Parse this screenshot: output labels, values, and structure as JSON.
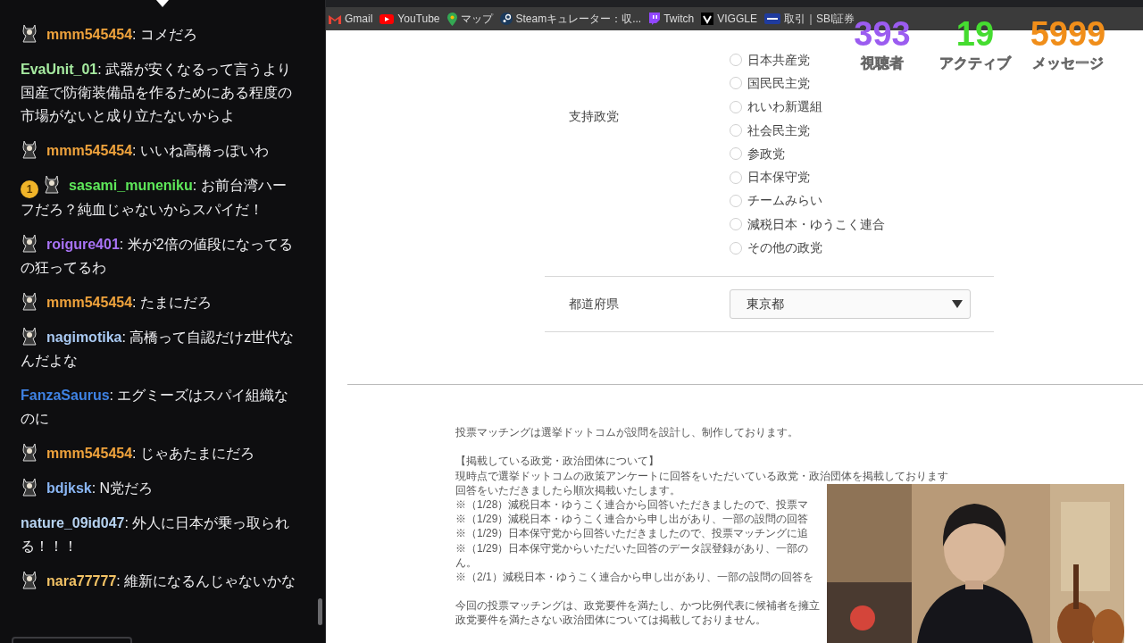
{
  "chat": {
    "messages": [
      {
        "badges": [
          {
            "kind": "avatar"
          }
        ],
        "user": "mmm545454",
        "color": "#eea23c",
        "text": ": コメだろ"
      },
      {
        "user": "EvaUnit_01",
        "color": "#a6eaa0",
        "text": ": 武器が安くなるって言うより国産で防衛装備品を作るためにある程度の市場がないと成り立たないからよ"
      },
      {
        "badges": [
          {
            "kind": "avatar"
          }
        ],
        "user": "mmm545454",
        "color": "#eea23c",
        "text": ": いいね高橋っぽいわ"
      },
      {
        "badges": [
          {
            "kind": "count",
            "text": "1"
          },
          {
            "kind": "avatar"
          }
        ],
        "user": "sasami_muneniku",
        "color": "#5ee85a",
        "text": ": お前台湾ハーフだろ？純血じゃないからスパイだ！"
      },
      {
        "badges": [
          {
            "kind": "avatar"
          }
        ],
        "user": "roigure401",
        "color": "#a873f5",
        "text": ": 米が2倍の値段になってるの狂ってるわ"
      },
      {
        "badges": [
          {
            "kind": "avatar"
          }
        ],
        "user": "mmm545454",
        "color": "#eea23c",
        "text": ": たまにだろ"
      },
      {
        "badges": [
          {
            "kind": "avatar"
          }
        ],
        "user": "nagimotika",
        "color": "#a9c9f2",
        "text": ": 高橋って自認だけz世代なんだよな"
      },
      {
        "user": "FanzaSaurus",
        "color": "#3f82e2",
        "text": ": エグミーズはスパイ組織なのに"
      },
      {
        "badges": [
          {
            "kind": "avatar"
          }
        ],
        "user": "mmm545454",
        "color": "#eea23c",
        "text": ": じゃあたまにだろ"
      },
      {
        "badges": [
          {
            "kind": "avatar"
          }
        ],
        "user": "bdjksk",
        "color": "#8ab6f4",
        "text": ": N党だろ"
      },
      {
        "user": "nature_09id047",
        "color": "#b6d2f0",
        "text": ": 外人に日本が乗っ取られる！！！"
      },
      {
        "badges": [
          {
            "kind": "avatar"
          }
        ],
        "user": "nara77777",
        "color": "#f2c265",
        "text": ": 維新になるんじゃないかな"
      }
    ]
  },
  "bookmarks": [
    {
      "kind": "gmail",
      "label": "Gmail"
    },
    {
      "kind": "youtube",
      "label": "YouTube"
    },
    {
      "kind": "maps",
      "label": "マップ"
    },
    {
      "kind": "steam",
      "label": "Steamキュレーター：収..."
    },
    {
      "kind": "twitch",
      "label": "Twitch"
    },
    {
      "kind": "viggle",
      "label": "VIGGLE"
    },
    {
      "kind": "sbi",
      "label": "取引｜SBI証券"
    }
  ],
  "stats": [
    {
      "value": "393",
      "label": "視聴者",
      "color": "#9b5cf0"
    },
    {
      "value": "19",
      "label": "アクティブ",
      "color": "#45dc30"
    },
    {
      "value": "5999",
      "label": "メッセージ",
      "color": "#f08e1a"
    }
  ],
  "form": {
    "party": {
      "label": "支持政党",
      "options": [
        {
          "label": "日本共産党",
          "selected": false
        },
        {
          "label": "国民民主党",
          "selected": false
        },
        {
          "label": "れいわ新選組",
          "selected": false
        },
        {
          "label": "社会民主党",
          "selected": false
        },
        {
          "label": "参政党",
          "selected": false
        },
        {
          "label": "日本保守党",
          "selected": false
        },
        {
          "label": "チームみらい",
          "selected": false
        },
        {
          "label": "減税日本・ゆうこく連合",
          "selected": false
        },
        {
          "label": "その他の政党",
          "selected": false
        }
      ]
    },
    "prefecture": {
      "label": "都道府県",
      "value": "東京都"
    }
  },
  "notice": [
    [
      "投票マッチングは選挙ドットコムが設問を設計し、制作しております。"
    ],
    [
      "【掲載している政党・政治団体について】",
      "現時点で選挙ドットコムの政策アンケートに回答をいただいている政党・政治団体を掲載しております",
      "回答をいただきましたら順次掲載いたします。",
      "※（1/28）減税日本・ゆうこく連合から回答いただきましたので、投票マ",
      "※（1/29）減税日本・ゆうこく連合から申し出があり、一部の設問の回答",
      "※（1/29）日本保守党から回答いただきましたので、投票マッチングに追",
      "※（1/29）日本保守党からいただいた回答のデータ誤登録があり、一部の",
      "ん。",
      "※（2/1）減税日本・ゆうこく連合から申し出があり、一部の設問の回答を"
    ],
    [
      "今回の投票マッチングは、政党要件を満たし、かつ比例代表に候補者を擁立",
      "政党要件を満たさない政治団体については掲載しておりません。"
    ]
  ],
  "webcam": {
    "kind": "picture"
  }
}
